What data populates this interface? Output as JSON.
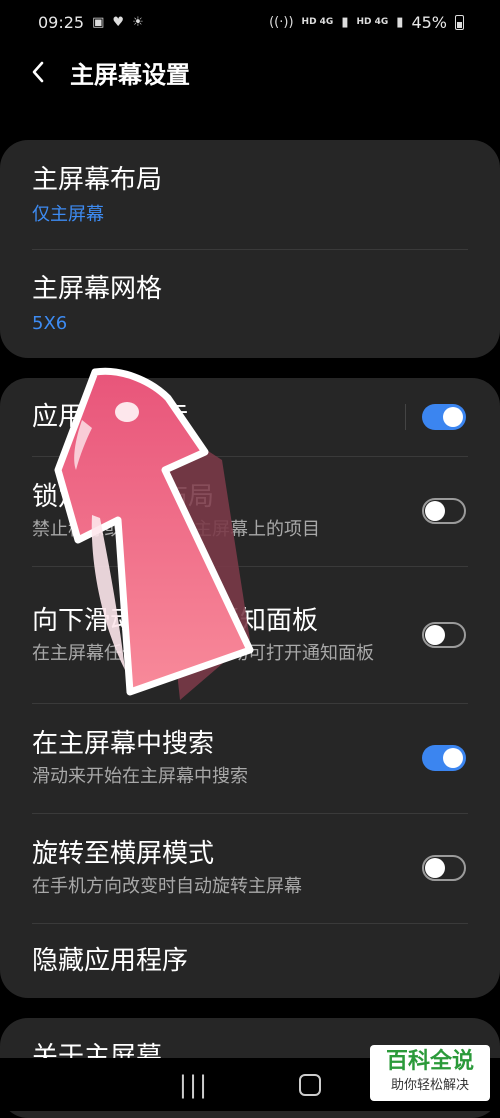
{
  "status": {
    "time": "09:25",
    "net1": "HD 4G",
    "net2": "HD 4G",
    "battery": "45%"
  },
  "header": {
    "title": "主屏幕设置"
  },
  "card1": {
    "items": [
      {
        "title": "主屏幕布局",
        "value": "仅主屏幕"
      },
      {
        "title": "主屏幕网格",
        "value": "5X6"
      }
    ]
  },
  "card2": {
    "items": [
      {
        "title": "应用程序图标",
        "subtitle": "",
        "toggle": true
      },
      {
        "title": "锁定主屏幕布局",
        "subtitle": "禁止移除或重新排列主屏幕上的项目",
        "toggle": false
      },
      {
        "title": "向下滑动以打开通知面板",
        "subtitle": "在主屏幕任何位置向下滑动可打开通知面板",
        "toggle": false
      },
      {
        "title": "在主屏幕中搜索",
        "subtitle": "滑动来开始在主屏幕中搜索",
        "toggle": true
      },
      {
        "title": "旋转至横屏模式",
        "subtitle": "在手机方向改变时自动旋转主屏幕",
        "toggle": false
      },
      {
        "title": "隐藏应用程序",
        "subtitle": ""
      }
    ]
  },
  "card3": {
    "title": "关于主屏幕"
  },
  "watermark": {
    "main": "百科全说",
    "sub": "助你轻松解决"
  },
  "colors": {
    "accent": "#3b85f0",
    "card": "#262626",
    "arrow": "#f06a86"
  }
}
